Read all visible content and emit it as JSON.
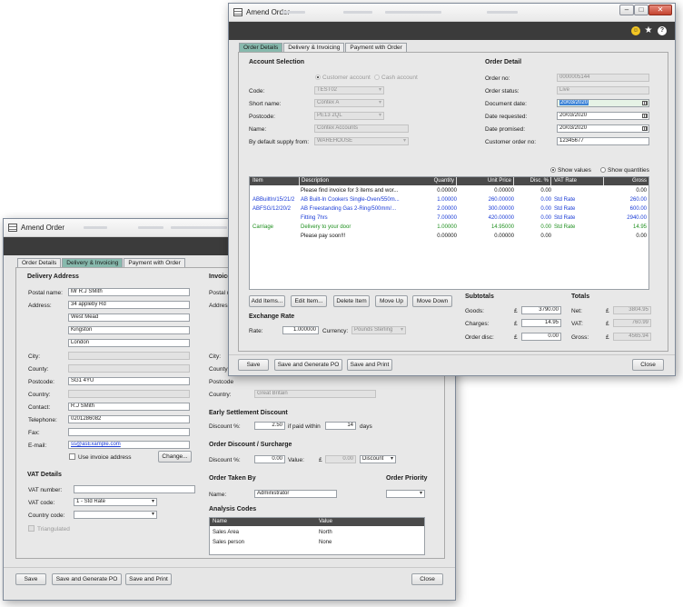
{
  "back": {
    "title": "Amend Order",
    "tabs": [
      "Order Details",
      "Delivery & Invoicing",
      "Payment with Order"
    ],
    "delivery_address": {
      "header": "Delivery Address",
      "postal_name_label": "Postal name:",
      "postal_name": "Mr R.J SMith",
      "address_label": "Address:",
      "address_lines": [
        "34 appleby Rd",
        "West Mead",
        "Kingston",
        "London"
      ],
      "city_label": "City:",
      "county_label": "County:",
      "postcode_label": "Postcode:",
      "postcode": "SG1 4YU",
      "country_label": "Country:",
      "contact_label": "Contact:",
      "contact": "R.J SMith",
      "telephone_label": "Telephone:",
      "telephone": "0201286082",
      "fax_label": "Fax:",
      "email_label": "E-mail:",
      "email": "ss@asExample.com",
      "use_invoice_label": "Use invoice address",
      "change_button": "Change..."
    },
    "vat_details": {
      "header": "VAT Details",
      "vat_number_label": "VAT number:",
      "vat_code_label": "VAT code:",
      "vat_code": "1 - Std Rate",
      "country_code_label": "Country code:",
      "triangulated_label": "Triangulated"
    },
    "invoice": {
      "header": "Invoice",
      "postal_label": "Postal n",
      "address_label": "Address",
      "city_label": "City:",
      "county_label": "County:",
      "postcode_label": "Postcode",
      "country_label": "Country:",
      "country": "Great Britain"
    },
    "early_settlement": {
      "header": "Early Settlement Discount",
      "discount_label": "Discount %:",
      "discount": "2.50",
      "if_paid_label": "if paid within",
      "days_value": "14",
      "days_label": "days"
    },
    "order_discount": {
      "header": "Order Discount / Surcharge",
      "discount_label": "Discount %:",
      "discount": "0.00",
      "value_label": "Value:",
      "currency_symbol": "£",
      "value": "0.00",
      "type": "Discount"
    },
    "order_taken": {
      "header": "Order Taken By",
      "name_label": "Name:",
      "name": "Administrator"
    },
    "order_priority": {
      "header": "Order Priority"
    },
    "analysis_codes": {
      "header": "Analysis Codes",
      "columns": [
        "Name",
        "Value"
      ],
      "rows": [
        {
          "name": "Sales Area",
          "value": "North"
        },
        {
          "name": "Sales person",
          "value": "None"
        }
      ]
    },
    "buttons": {
      "save": "Save",
      "save_po": "Save and Generate PO",
      "save_print": "Save and Print",
      "close": "Close"
    }
  },
  "front": {
    "title": "Amend Order",
    "tabs": [
      "Order Details",
      "Delivery & Invoicing",
      "Payment with Order"
    ],
    "account_selection": {
      "header": "Account Selection",
      "customer_account": "Customer account",
      "cash_account": "Cash account",
      "code_label": "Code:",
      "code": "TEST02",
      "short_name_label": "Short name:",
      "short_name": "Contex A",
      "postcode_label": "Postcode:",
      "postcode": "PE13 2QL",
      "name_label": "Name:",
      "name": "Contex Accounts",
      "supply_label": "By default supply from:",
      "supply": "WAREHOUSE"
    },
    "order_detail": {
      "header": "Order Detail",
      "order_no_label": "Order no:",
      "order_no": "0000005144",
      "status_label": "Order status:",
      "status": "Live",
      "doc_date_label": "Document date:",
      "doc_date": "20/03/2020",
      "requested_label": "Date requested:",
      "requested": "20/03/2020",
      "promised_label": "Date promised:",
      "promised": "20/03/2020",
      "cust_order_label": "Customer order no:",
      "cust_order": "12345677"
    },
    "show_values": "Show values",
    "show_quantities": "Show quantities",
    "grid": {
      "columns": [
        "Item",
        "Description",
        "Quantity",
        "Unit Price",
        "Disc. %",
        "VAT Rate",
        "Gross"
      ],
      "rows": [
        {
          "item": "",
          "desc": "Please find invoice for 3 items and wor...",
          "qty": "0.00000",
          "price": "0.00000",
          "disc": "0.00",
          "vat": "",
          "gross": "0.00",
          "color": "black"
        },
        {
          "item": "ABBuiltIn/15/21/2",
          "desc": "AB Built-In Cookers Single-Oven/550m...",
          "qty": "1.00000",
          "price": "260.00000",
          "disc": "0.00",
          "vat": "Std Rate",
          "gross": "260.00",
          "color": "blue"
        },
        {
          "item": "ABFSG/12/20/2",
          "desc": "AB Freestanding Gas 2-Ring/500mm/...",
          "qty": "2.00000",
          "price": "300.00000",
          "disc": "0.00",
          "vat": "Std Rate",
          "gross": "600.00",
          "color": "blue"
        },
        {
          "item": "",
          "desc": "Fitting 7hrs",
          "qty": "7.00000",
          "price": "420.00000",
          "disc": "0.00",
          "vat": "Std Rate",
          "gross": "2940.00",
          "color": "blue"
        },
        {
          "item": "Carriage",
          "desc": "Delivery to your door",
          "qty": "1.00000",
          "price": "14.95000",
          "disc": "0.00",
          "vat": "Std Rate",
          "gross": "14.95",
          "color": "green"
        },
        {
          "item": "",
          "desc": "Please pay soon!!!",
          "qty": "0.00000",
          "price": "0.00000",
          "disc": "0.00",
          "vat": "",
          "gross": "0.00",
          "color": "black"
        }
      ]
    },
    "line_buttons": {
      "add": "Add Items...",
      "edit": "Edit Item...",
      "delete": "Delete Item",
      "up": "Move Up",
      "down": "Move Down"
    },
    "exchange": {
      "header": "Exchange Rate",
      "rate_label": "Rate:",
      "rate": "1.000000",
      "currency_label": "Currency:",
      "currency": "Pounds Sterling"
    },
    "subtotals": {
      "header": "Subtotals",
      "goods_label": "Goods:",
      "goods": "3790.00",
      "charges_label": "Charges:",
      "charges": "14.95",
      "order_disc_label": "Order disc:",
      "order_disc": "0.00",
      "currency_symbol": "£"
    },
    "totals": {
      "header": "Totals",
      "net_label": "Net:",
      "net": "3804.95",
      "vat_label": "VAT:",
      "vat": "760.99",
      "gross_label": "Gross:",
      "gross": "4565.94",
      "currency_symbol": "£"
    },
    "buttons": {
      "save": "Save",
      "save_po": "Save and Generate PO",
      "save_print": "Save and Print",
      "close": "Close"
    },
    "colors": {
      "accent": "#87b9ad",
      "link_blue": "#1a3bd6",
      "charge_green": "#1e8f1e",
      "title_band": "#3b3b3b"
    }
  }
}
